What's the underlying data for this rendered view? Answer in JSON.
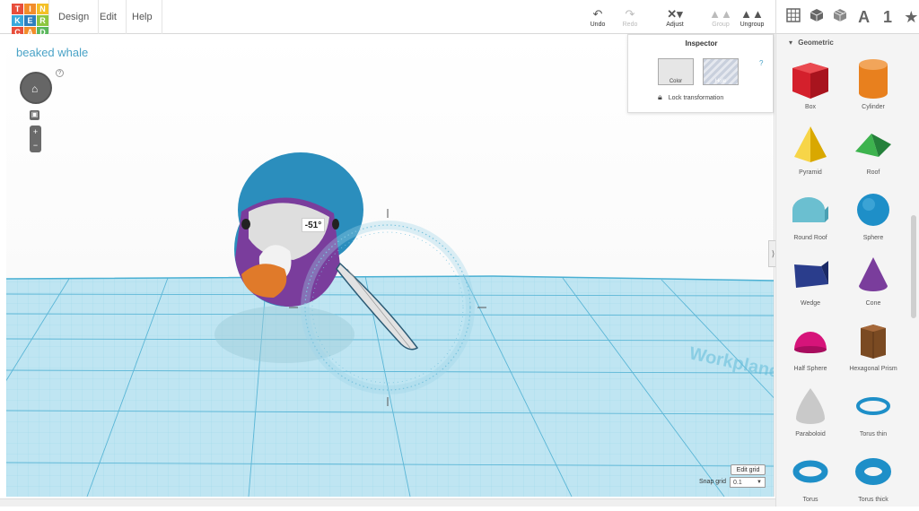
{
  "logo": {
    "letters": [
      "T",
      "I",
      "N",
      "K",
      "E",
      "R",
      "C",
      "A",
      "D"
    ],
    "colors": [
      "#e84e3b",
      "#f28d2a",
      "#f4c026",
      "#38a9dc",
      "#2d7fbe",
      "#8dc63f",
      "#e84e3b",
      "#f28d2a",
      "#5bb85d"
    ]
  },
  "menu": {
    "design": "Design",
    "edit": "Edit",
    "help": "Help"
  },
  "toolbar": {
    "undo": "Undo",
    "redo": "Redo",
    "adjust": "Adjust",
    "group": "Group",
    "ungroup": "Ungroup"
  },
  "view_icons": [
    "grid-icon",
    "cube-icon",
    "cube-outline-icon",
    "A",
    "1",
    "★"
  ],
  "design_title": "beaked whale",
  "help_mark": "?",
  "rotation_label": "-51°",
  "inspector": {
    "title": "Inspector",
    "color_label": "Color",
    "hole_label": "Hole",
    "help": "?",
    "lock_label": "Lock transformation"
  },
  "panel": {
    "section": "Geometric",
    "shapes": [
      {
        "label": "Box",
        "icon": "box-icon",
        "color": "#d4202c"
      },
      {
        "label": "Cylinder",
        "icon": "cylinder-icon",
        "color": "#e8801e"
      },
      {
        "label": "Pyramid",
        "icon": "pyramid-icon",
        "color": "#f2c200"
      },
      {
        "label": "Roof",
        "icon": "roof-icon",
        "color": "#2f9a3d"
      },
      {
        "label": "Round Roof",
        "icon": "round-roof-icon",
        "color": "#6bbfd0"
      },
      {
        "label": "Sphere",
        "icon": "sphere-icon",
        "color": "#1e8fc8"
      },
      {
        "label": "Wedge",
        "icon": "wedge-icon",
        "color": "#2a3d8c"
      },
      {
        "label": "Cone",
        "icon": "cone-icon",
        "color": "#7a3d9c"
      },
      {
        "label": "Half Sphere",
        "icon": "half-sphere-icon",
        "color": "#d6147a"
      },
      {
        "label": "Hexagonal Prism",
        "icon": "hexagonal-prism-icon",
        "color": "#7a4a22"
      },
      {
        "label": "Paraboloid",
        "icon": "paraboloid-icon",
        "color": "#c9c9c9"
      },
      {
        "label": "Torus thin",
        "icon": "torus-thin-icon",
        "color": "#1e8fc8"
      },
      {
        "label": "Torus",
        "icon": "torus-icon",
        "color": "#1e8fc8"
      },
      {
        "label": "Torus thick",
        "icon": "torus-thick-icon",
        "color": "#1e8fc8"
      }
    ]
  },
  "grid": {
    "edit_label": "Edit grid",
    "snap_label": "Snap grid",
    "snap_value": "0.1"
  },
  "colors": {
    "accent": "#4aa3c7",
    "whale_body": "#2b8ebd",
    "whale_side": "#7a3d9c",
    "beak": "#e07a2a",
    "workplane": "#7ccbe4"
  }
}
